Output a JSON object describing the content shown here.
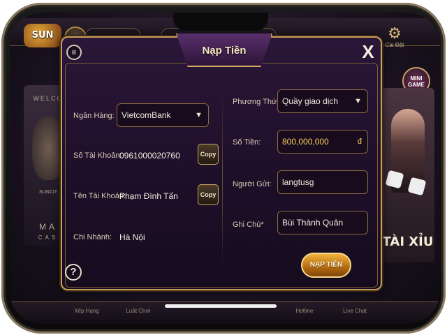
{
  "modal": {
    "title": "Nạp Tiền",
    "close_label": "X",
    "help_label": "?",
    "left": {
      "bank_label": "Ngân Hàng:",
      "bank_value": "VietcomBank",
      "account_number_label": "Số Tài Khoản:",
      "account_number_value": "0961000020760",
      "account_name_label": "Tên Tài Khoản:",
      "account_name_value": "Phạm Đình Tấn",
      "branch_label": "Chi Nhánh:",
      "branch_value": "Hà Nội",
      "copy_label": "Copy"
    },
    "right": {
      "method_label": "Phương Thức:",
      "method_value": "Quầy giao dịch",
      "amount_label": "Số Tiền:",
      "amount_value": "800,000,000",
      "amount_unit": "đ",
      "sender_label": "Người Gửi:",
      "sender_value": "langtusg",
      "note_label": "Ghi Chú*",
      "note_value": "Bùi Thành Quân"
    },
    "submit_label": "NẠP TIỀN"
  },
  "background": {
    "logo": "SUN",
    "settings_label": "Cài Đặt",
    "promo_left_top": "WELCO",
    "promo_left_brand": "SUNCIT",
    "promo_left_bottom": "MA",
    "promo_left_bottom2": "CAS",
    "minigame_label": "MINI GAME",
    "promo_right_label": "TÀI XỈU",
    "bottom_items": [
      "Xếp Hạng",
      "Luật Chơi",
      "Hotline",
      "Live Chat"
    ]
  },
  "colors": {
    "accent_gold": "#c9a05a",
    "amount_gold": "#ffd35a",
    "modal_bg": "#2b1638"
  }
}
